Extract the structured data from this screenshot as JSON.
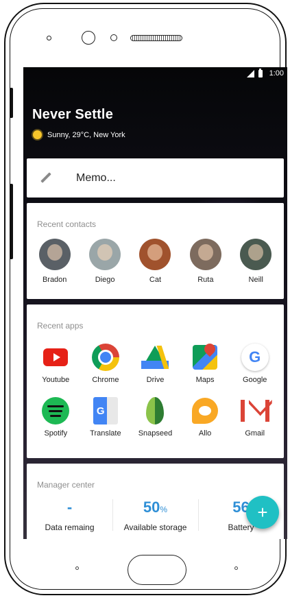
{
  "status_bar": {
    "time": "1:00"
  },
  "header": {
    "headline": "Never Settle",
    "weather": "Sunny, 29°C, New York"
  },
  "memo": {
    "placeholder": "Memo..."
  },
  "recent_contacts": {
    "title": "Recent contacts",
    "items": [
      {
        "name": "Bradon",
        "color": "#5a6066"
      },
      {
        "name": "Diego",
        "color": "#9aa6a8"
      },
      {
        "name": "Cat",
        "color": "#a0522d"
      },
      {
        "name": "Ruta",
        "color": "#7d6b5e"
      },
      {
        "name": "Neill",
        "color": "#4a5a50"
      }
    ]
  },
  "recent_apps": {
    "title": "Recent apps",
    "items": [
      {
        "name": "Youtube",
        "icon": "youtube-icon"
      },
      {
        "name": "Chrome",
        "icon": "chrome-icon"
      },
      {
        "name": "Drive",
        "icon": "drive-icon"
      },
      {
        "name": "Maps",
        "icon": "maps-icon"
      },
      {
        "name": "Google",
        "icon": "google-icon"
      },
      {
        "name": "Spotify",
        "icon": "spotify-icon"
      },
      {
        "name": "Translate",
        "icon": "translate-icon"
      },
      {
        "name": "Snapseed",
        "icon": "snapseed-icon"
      },
      {
        "name": "Allo",
        "icon": "allo-icon"
      },
      {
        "name": "Gmail",
        "icon": "gmail-icon"
      }
    ]
  },
  "manager_center": {
    "title": "Manager center",
    "stats": [
      {
        "value": "-",
        "unit": "",
        "label": "Data remaing"
      },
      {
        "value": "50",
        "unit": "%",
        "label": "Available storage"
      },
      {
        "value": "56",
        "unit": "",
        "label": "Battery"
      }
    ]
  },
  "fab": {
    "label": "+"
  },
  "colors": {
    "accent": "#2f8fd6",
    "fab": "#20c0c4"
  }
}
